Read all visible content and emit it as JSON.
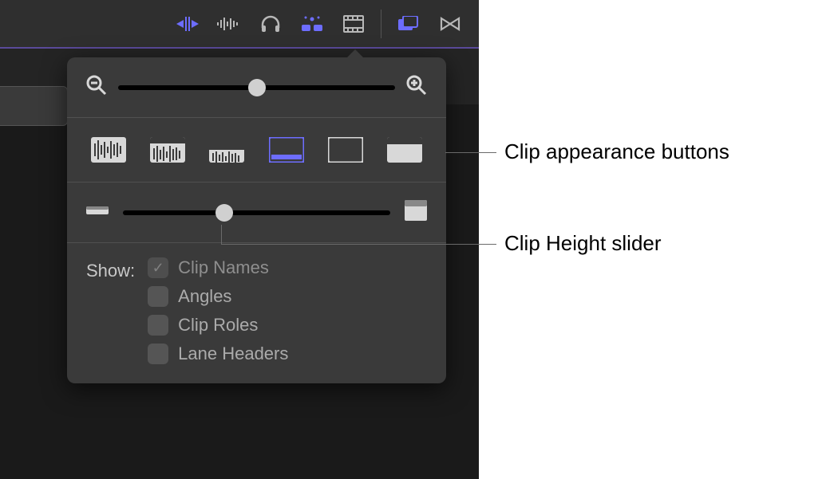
{
  "toolbar": {
    "icons": [
      {
        "name": "trim-icon",
        "active": true
      },
      {
        "name": "audio-waveform-icon",
        "active": false
      },
      {
        "name": "headphones-icon",
        "active": false
      },
      {
        "name": "appearance-icon",
        "active": true
      },
      {
        "name": "filmstrip-icon",
        "active": false
      }
    ],
    "right_icons": [
      {
        "name": "windows-icon",
        "active": true
      },
      {
        "name": "bowtie-icon",
        "active": false
      }
    ]
  },
  "popover": {
    "zoom": {
      "slider_percent": 50
    },
    "appearance": {
      "buttons": [
        {
          "name": "appearance-waveform-only",
          "active": false
        },
        {
          "name": "appearance-waveform-large",
          "active": false
        },
        {
          "name": "appearance-waveform-small",
          "active": false
        },
        {
          "name": "appearance-bar-waveform",
          "active": true
        },
        {
          "name": "appearance-filmstrip-waveform",
          "active": false
        },
        {
          "name": "appearance-filmstrip-only",
          "active": false
        }
      ]
    },
    "clip_height": {
      "slider_percent": 38
    },
    "show": {
      "label": "Show:",
      "options": [
        {
          "label": "Clip Names",
          "checked": true,
          "disabled": true
        },
        {
          "label": "Angles",
          "checked": false,
          "disabled": false
        },
        {
          "label": "Clip Roles",
          "checked": false,
          "disabled": false
        },
        {
          "label": "Lane Headers",
          "checked": false,
          "disabled": false
        }
      ]
    }
  },
  "annotations": {
    "appearance_buttons": "Clip appearance buttons",
    "height_slider": "Clip Height slider"
  }
}
